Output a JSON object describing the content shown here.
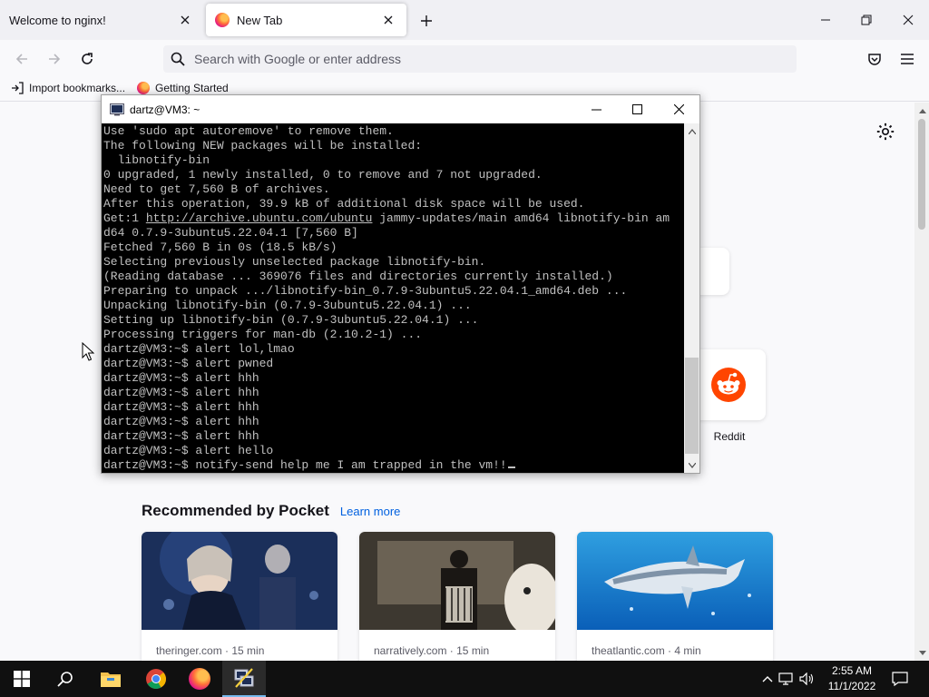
{
  "browser": {
    "tabs": [
      {
        "title": "Welcome to nginx!",
        "active": false
      },
      {
        "title": "New Tab",
        "active": true
      }
    ],
    "url_placeholder": "Search with Google or enter address",
    "bookmarks": [
      "Import bookmarks...",
      "Getting Started"
    ]
  },
  "newtab": {
    "shortcut_label": "Reddit",
    "pocket_title": "Recommended by Pocket",
    "pocket_learn_more": "Learn more",
    "cards": [
      {
        "source": "theringer.com · 15 min"
      },
      {
        "source": "narratively.com · 15 min"
      },
      {
        "source": "theatlantic.com · 4 min"
      }
    ]
  },
  "terminal": {
    "title": "dartz@VM3: ~",
    "lines": [
      "Use 'sudo apt autoremove' to remove them.",
      "The following NEW packages will be installed:",
      "  libnotify-bin",
      "0 upgraded, 1 newly installed, 0 to remove and 7 not upgraded.",
      "Need to get 7,560 B of archives.",
      "After this operation, 39.9 kB of additional disk space will be used.",
      "d64 0.7.9-3ubuntu5.22.04.1 [7,560 B]",
      "Fetched 7,560 B in 0s (18.5 kB/s)",
      "Selecting previously unselected package libnotify-bin.",
      "(Reading database ... 369076 files and directories currently installed.)",
      "Preparing to unpack .../libnotify-bin_0.7.9-3ubuntu5.22.04.1_amd64.deb ...",
      "Unpacking libnotify-bin (0.7.9-3ubuntu5.22.04.1) ...",
      "Setting up libnotify-bin (0.7.9-3ubuntu5.22.04.1) ...",
      "Processing triggers for man-db (2.10.2-1) ...",
      "dartz@VM3:~$ alert lol,lmao",
      "dartz@VM3:~$ alert pwned",
      "dartz@VM3:~$ alert hhh",
      "dartz@VM3:~$ alert hhh",
      "dartz@VM3:~$ alert hhh",
      "dartz@VM3:~$ alert hhh",
      "dartz@VM3:~$ alert hhh",
      "dartz@VM3:~$ alert hello",
      "dartz@VM3:~$ notify-send help me I am trapped in the vm!!"
    ],
    "get_line": {
      "prefix": "Get:1 ",
      "url": "http://archive.ubuntu.com/ubuntu",
      "suffix": " jammy-updates/main amd64 libnotify-bin am"
    }
  },
  "taskbar": {
    "time": "2:55 AM",
    "date": "11/1/2022"
  },
  "colors": {
    "accent": "#0061e0",
    "terminal_bg": "#000000",
    "terminal_fg": "#c0c0c0",
    "taskbar_bg": "#101010"
  },
  "icons": [
    "firefox-icon",
    "close-icon",
    "plus-icon",
    "back-icon",
    "forward-icon",
    "reload-icon",
    "search-icon",
    "pocket-icon",
    "menu-icon",
    "import-icon",
    "gear-icon",
    "reddit-icon",
    "windows-start-icon",
    "search-taskbar-icon",
    "file-explorer-icon",
    "chrome-icon",
    "putty-icon",
    "chevron-up-icon",
    "network-icon",
    "volume-icon",
    "notification-icon"
  ]
}
